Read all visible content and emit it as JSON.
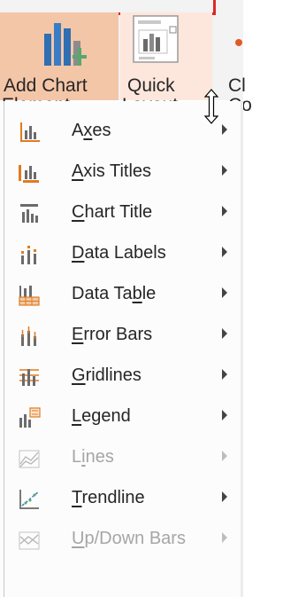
{
  "ribbon": {
    "add_chart_element": {
      "line1": "Add Chart",
      "line2_prefix": "Element",
      "dropdown_glyph": "▾"
    },
    "quick_layout": {
      "line1": "Quick",
      "line2_prefix": "Layout",
      "dropdown_glyph": "▾"
    },
    "next_button": {
      "line1": "Cl",
      "line2": "Co"
    }
  },
  "menu": {
    "items": [
      {
        "pre": "A",
        "key": "x",
        "post": "es",
        "icon": "axes-icon",
        "enabled": true
      },
      {
        "pre": "",
        "key": "A",
        "post": "xis Titles",
        "icon": "axis-titles-icon",
        "enabled": true
      },
      {
        "pre": "",
        "key": "C",
        "post": "hart Title",
        "icon": "chart-title-icon",
        "enabled": true
      },
      {
        "pre": "",
        "key": "D",
        "post": "ata Labels",
        "icon": "data-labels-icon",
        "enabled": true
      },
      {
        "pre": "Data Ta",
        "key": "b",
        "post": "le",
        "icon": "data-table-icon",
        "enabled": true
      },
      {
        "pre": "",
        "key": "E",
        "post": "rror Bars",
        "icon": "error-bars-icon",
        "enabled": true
      },
      {
        "pre": "",
        "key": "G",
        "post": "ridlines",
        "icon": "gridlines-icon",
        "enabled": true
      },
      {
        "pre": "",
        "key": "L",
        "post": "egend",
        "icon": "legend-icon",
        "enabled": true
      },
      {
        "pre": "L",
        "key": "i",
        "post": "nes",
        "icon": "lines-icon",
        "enabled": false
      },
      {
        "pre": "",
        "key": "T",
        "post": "rendline",
        "icon": "trendline-icon",
        "enabled": true
      },
      {
        "pre": "",
        "key": "U",
        "post": "p/Down Bars",
        "icon": "up-down-bars-icon",
        "enabled": false
      }
    ]
  },
  "colors": {
    "highlight": "#f4c6a8",
    "hover": "#fde7dd",
    "annotation_box": "#e0262b",
    "accent_orange": "#e07b21",
    "icon_blue": "#2f6fb2",
    "icon_green": "#5aa66e"
  }
}
